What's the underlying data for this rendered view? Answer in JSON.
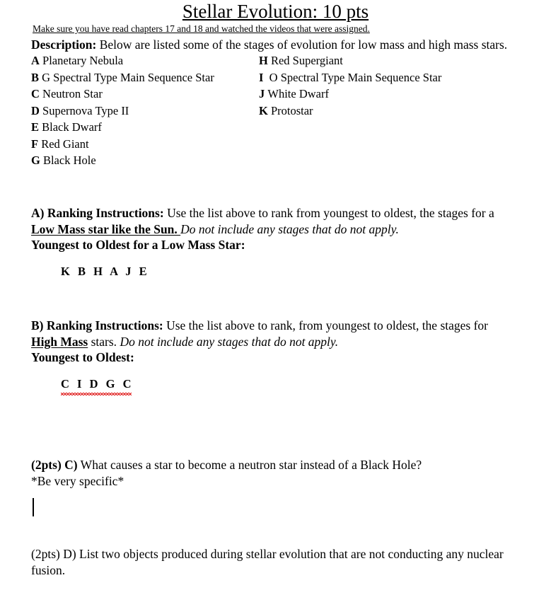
{
  "document": {
    "title": "Stellar Evolution: 10 pts",
    "subtitle": "Make sure you have read chapters 17 and 18 and watched the videos that were assigned.",
    "description_label": "Description:",
    "description_text": " Below are listed some of the stages of evolution for low mass and high mass stars."
  },
  "stages": {
    "left_column": [
      {
        "letter": "A",
        "name": "Planetary Nebula"
      },
      {
        "letter": "B",
        "name": "G Spectral Type Main Sequence Star"
      },
      {
        "letter": "C",
        "name": "Neutron Star"
      },
      {
        "letter": "D",
        "name": "Supernova Type II"
      },
      {
        "letter": "E",
        "name": "Black Dwarf"
      },
      {
        "letter": "F",
        "name": "Red Giant"
      },
      {
        "letter": "G",
        "name": "Black Hole"
      }
    ],
    "right_column": [
      {
        "letter": "H",
        "name": "Red Supergiant"
      },
      {
        "letter": "I",
        "name": "O Spectral Type Main Sequence Star"
      },
      {
        "letter": "J",
        "name": "White Dwarf"
      },
      {
        "letter": "K",
        "name": "Protostar"
      }
    ]
  },
  "question_a": {
    "label": "A) Ranking Instructions:",
    "line1_rest": " Use the list above to rank from youngest to oldest, the stages for a",
    "emphasis": "Low Mass star like the Sun. ",
    "italic_note": "Do not include any stages that do not apply.",
    "prompt": "Youngest to Oldest for a Low Mass Star:",
    "answer": "K B H A J E"
  },
  "question_b": {
    "label": "B) Ranking Instructions:",
    "line1_rest": " Use the list above to rank, from youngest to oldest, the stages for",
    "emphasis": "High Mass",
    "after_emphasis": " stars. ",
    "italic_note": "Do not include any stages that do not apply.",
    "prompt": "Youngest to Oldest:",
    "answer": "C I D G C"
  },
  "question_c": {
    "label": "(2pts) C)",
    "text": " What causes a star to become a neutron star instead of a Black Hole?",
    "note": "*Be very specific*"
  },
  "question_d": {
    "line1": "(2pts) D) List two objects produced during stellar evolution that are not conducting any nuclear",
    "line2": "fusion."
  }
}
